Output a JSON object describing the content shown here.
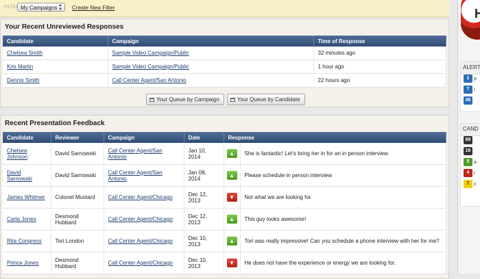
{
  "filterbar": {
    "label": "FILTER",
    "select_value": "My Campaigns",
    "new_filter_link": "Create New Filter"
  },
  "unreviewed": {
    "title": "Your Recent Unreviewed Responses",
    "headers": [
      "Candidate",
      "Campaign",
      "Time of Response"
    ],
    "rows": [
      {
        "candidate": "Chelsea Smith",
        "campaign": "Sample Video Campaign/Public",
        "time": "32 minutes ago"
      },
      {
        "candidate": "Kris Martin",
        "campaign": "Sample Video Campaign/Public",
        "time": "1 hour ago"
      },
      {
        "candidate": "Dennis Smith",
        "campaign": "Call Center Agent/San Antonio",
        "time": "22 hours ago"
      }
    ],
    "buttons": {
      "by_campaign": "Your Queue by Campaign",
      "by_candidate": "Your Queue by Candidate"
    }
  },
  "feedback": {
    "title": "Recent Presentation Feedback",
    "headers": [
      "Candidate",
      "Reviewer",
      "Campaign",
      "Date",
      "Response",
      ""
    ],
    "rows": [
      {
        "candidate": "Chelsea Johnson",
        "reviewer": "David Sarnowski",
        "campaign": "Call Center Agent/San Antonio",
        "date": "Jan 10, 2014",
        "response": "up",
        "comment": "She is fantastic! Let's bring her in for an in person interview."
      },
      {
        "candidate": "David Sarnowski",
        "reviewer": "David Sarnowski",
        "campaign": "Call Center Agent/San Antonio",
        "date": "Jan 08, 2014",
        "response": "up",
        "comment": "Please schedule in person interview"
      },
      {
        "candidate": "James Whitmer",
        "reviewer": "Colonel Mustard",
        "campaign": "Call Center Agent/Chicago",
        "date": "Dec 12, 2013",
        "response": "down",
        "comment": "Not what we are looking for."
      },
      {
        "candidate": "Carla Jones",
        "reviewer": "Desmond Hubbard",
        "campaign": "Call Center Agent/Chicago",
        "date": "Dec 12, 2013",
        "response": "up",
        "comment": "This guy looks awesome!"
      },
      {
        "candidate": "Rita Congress",
        "reviewer": "Tori London",
        "campaign": "Call Center Agent/Chicago",
        "date": "Dec 10, 2013",
        "response": "up",
        "comment": "Tori was really impressive! Can you schedule a phone interview with her for me?"
      },
      {
        "candidate": "Prince Jones",
        "reviewer": "Desmond Hubbard",
        "campaign": "Call Center Agent/Chicago",
        "date": "Dec 10, 2013",
        "response": "down",
        "comment": "He does not have the experience or energy we are looking for."
      }
    ]
  },
  "sidebar": {
    "logo_letter": "H",
    "alerts": {
      "heading": "ALERT",
      "items": [
        {
          "count": "1",
          "label": "p",
          "color": "#2a6fb5"
        },
        {
          "count": "7",
          "label": "i",
          "color": "#2a6fb5"
        },
        {
          "count": "46",
          "label": "",
          "color": "#2a6fb5"
        }
      ]
    },
    "candidates": {
      "heading": "CAND",
      "items": [
        {
          "count": "69",
          "label": "",
          "color": "#333333"
        },
        {
          "count": "16",
          "label": "",
          "color": "#333333"
        },
        {
          "count": "5",
          "label": "a",
          "color": "#4f9a2a"
        },
        {
          "count": "4",
          "label": "r",
          "color": "#c0241a"
        },
        {
          "count": "7",
          "label": "c",
          "color": "#f0d000"
        }
      ]
    }
  },
  "colors": {
    "thumb_up": "#5aa82f",
    "thumb_down": "#c72d20",
    "header_blue": "#3d5a82"
  }
}
